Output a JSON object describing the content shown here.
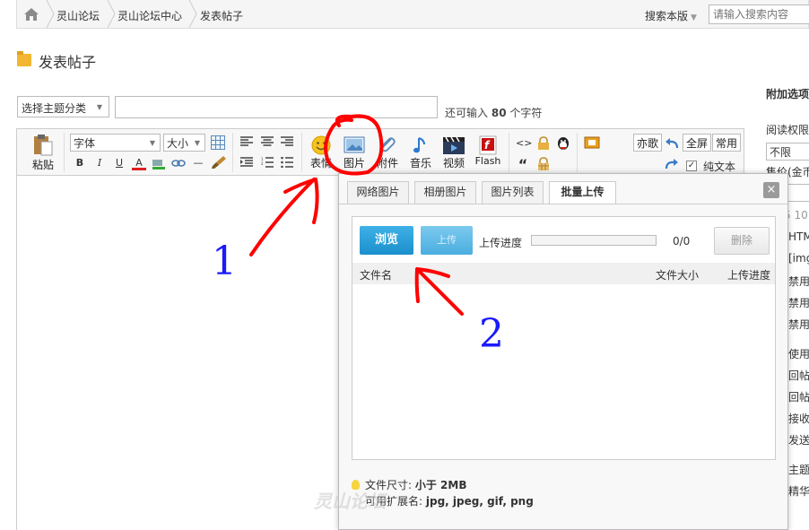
{
  "breadcrumb": {
    "items": [
      "灵山论坛",
      "灵山论坛中心",
      "发表帖子"
    ]
  },
  "search": {
    "mode_label": "搜索本版",
    "placeholder": "请输入搜索内容"
  },
  "page": {
    "title": "发表帖子"
  },
  "subject_row": {
    "topic_select": "选择主题分类",
    "remain_prefix": "还可输入",
    "remain_count": "80",
    "remain_suffix": "个字符"
  },
  "toolbar": {
    "paste_label": "粘贴",
    "font_select": "字体",
    "size_select": "大小",
    "format_buttons": [
      "B",
      "I",
      "U",
      "A"
    ],
    "emoticon_label": "表情",
    "image_label": "图片",
    "attach_label": "附件",
    "music_label": "音乐",
    "video_label": "视频",
    "flash_label": "Flash",
    "right_buttons": [
      "亦歌",
      "全屏",
      "常用"
    ],
    "plain_text_label": "纯文本",
    "plain_text_checked": true
  },
  "sidebar": {
    "title": "附加选项",
    "items": [
      "阅读权限",
      "售价(金币",
      "5 10",
      "HTM",
      "[img",
      "禁用",
      "禁用",
      "禁用",
      "使用",
      "回帖",
      "回帖",
      "接收",
      "发送",
      "主题",
      "精华"
    ],
    "read_perm_value": "不限"
  },
  "dialog": {
    "tabs": [
      "网络图片",
      "相册图片",
      "图片列表",
      "批量上传"
    ],
    "active_tab": "批量上传",
    "close": "×",
    "browse_label": "浏览",
    "upload_label": "上传",
    "progress_label": "上传进度",
    "progress_count": "0/0",
    "progress_fraction": 0,
    "delete_label": "删除",
    "columns": [
      "文件名",
      "文件大小",
      "上传进度"
    ],
    "size_limit_label": "文件尺寸:",
    "size_limit_value": "小于 2MB",
    "ext_label": "可用扩展名:",
    "ext_value": "jpg, jpeg, gif, png"
  },
  "annotations": {
    "step1": "1",
    "step2": "2",
    "color": "#1a1aff",
    "arrow_color": "#ff0000"
  },
  "watermark": "灵山论坛"
}
